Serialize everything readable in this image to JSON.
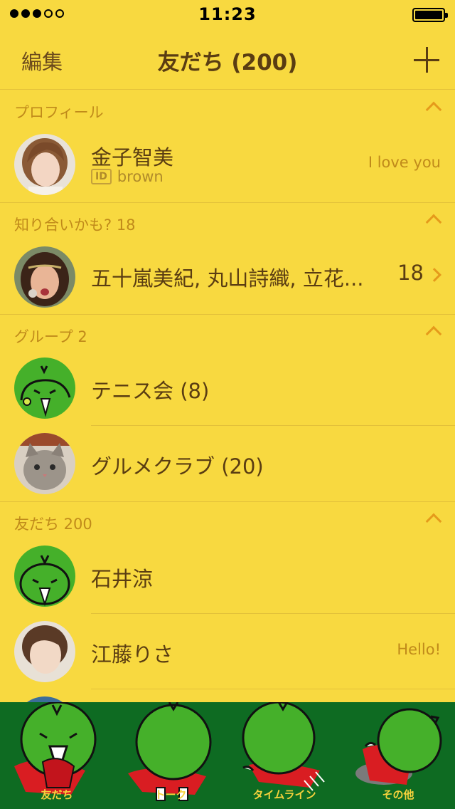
{
  "status_bar": {
    "time": "11:23"
  },
  "nav": {
    "edit_label": "編集",
    "title": "友だち (200)"
  },
  "profile": {
    "header": "プロフィール",
    "name": "金子智美",
    "id_badge": "ID",
    "user_id": "brown",
    "status_message": "I love you"
  },
  "recommended": {
    "header": "知り合いかも? 18",
    "names": "五十嵐美紀, 丸山詩織, 立花...",
    "count": "18"
  },
  "groups": {
    "header": "グループ 2",
    "items": [
      {
        "name": "テニス会 (8)"
      },
      {
        "name": "グルメクラブ (20)"
      }
    ]
  },
  "friends": {
    "header": "友だち 200",
    "items": [
      {
        "name": "石井涼",
        "message": ""
      },
      {
        "name": "江藤りさ",
        "message": "Hello!"
      }
    ]
  },
  "tab_bar": {
    "tabs": [
      {
        "label": "友だち"
      },
      {
        "label": "トーク"
      },
      {
        "label": "タイムライン"
      },
      {
        "label": "その他"
      }
    ]
  },
  "colors": {
    "background": "#f8d940",
    "text": "#5a3d12",
    "accent": "#e59a1b",
    "tab_bar": "#0e6b22",
    "character_green": "#45b02a"
  },
  "icons": {
    "add": "plus-icon",
    "collapse": "chevron-up-icon",
    "disclosure": "chevron-right-icon"
  }
}
